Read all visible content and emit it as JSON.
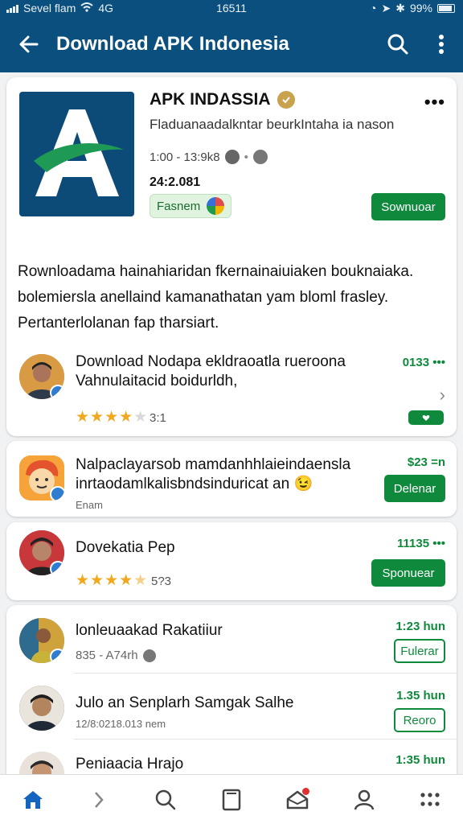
{
  "status_bar": {
    "carrier": "Sevel flam",
    "network": "4G",
    "time": "16511",
    "battery": "99%"
  },
  "app_bar": {
    "title": "Download APK Indonesia"
  },
  "featured": {
    "name": "APK INDASSIA",
    "description": "Fladuanaadalkntar beurkIntaha ia nason",
    "meta": "1:00 - 13:9k8",
    "count": "24:2.081",
    "chip_label": "Fasnem",
    "download_label": "Sownuoar",
    "paragraph": "Rownloadama hainahiaridan fkernainaiuiaken bouknaiaka. bolemiersla anellaind kamanathatan yam bloml frasley. Pertanterlolanan fap tharsiart.",
    "colors": {
      "logo_bg": "#0c4a78",
      "accent": "#0f8a3c"
    }
  },
  "items": [
    {
      "title": "Download Nodapa ekldraoatla rueroona Vahnulaitacid boidurldh,",
      "time": "0133 •••",
      "rating": "3:1"
    },
    {
      "title": "Nalpaclayarsob mamdanhhlaieindaensla inrtaodamlkalisbndsinduricat an",
      "sub": "Enam",
      "time": "$23 =n",
      "button": "Delenar"
    },
    {
      "title": "Dovekatia Pep",
      "time": "11135 •••",
      "rating": "5?3",
      "button": "Sponuear"
    },
    {
      "title": "lonleuaakad Rakatiiur",
      "sub": "835 - A74rh",
      "time": "1:23 hun",
      "button": "Fulerar"
    },
    {
      "title": "Julo an Senplarh Samgak Salhe",
      "sub": "12/8:0218.013 nem",
      "time": "1.35 hun",
      "button": "Reoro"
    },
    {
      "title": "Peniaacia Hrajo",
      "time": "1:35 hun"
    }
  ]
}
